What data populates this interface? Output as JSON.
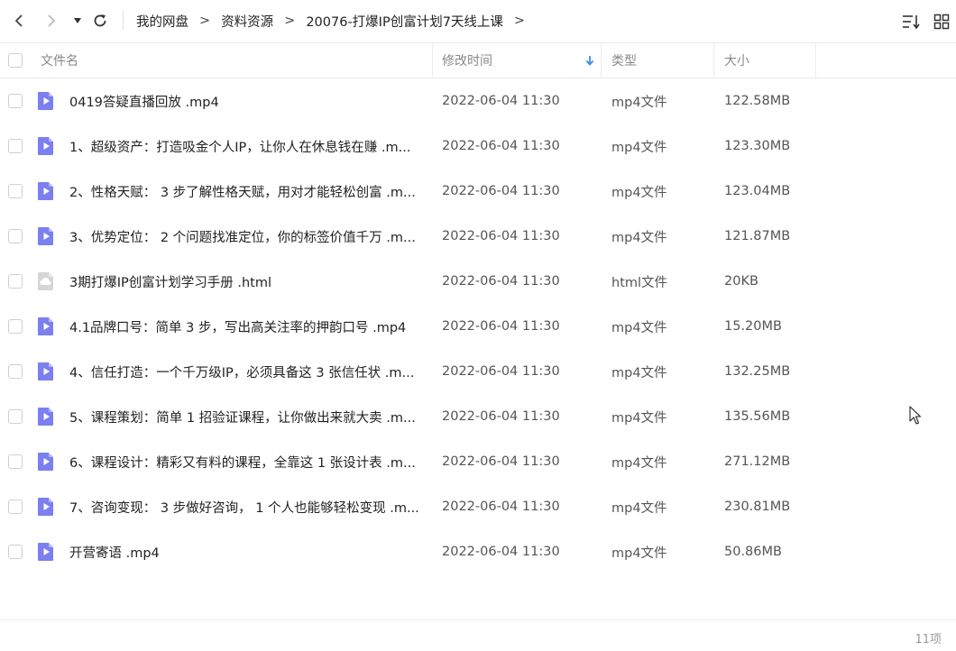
{
  "nav": {
    "back_icon": "chevron-left-icon",
    "forward_icon": "chevron-right-icon",
    "dropdown_icon": "caret-down-icon",
    "refresh_icon": "refresh-icon",
    "breadcrumb": [
      "我的网盘",
      "资料资源",
      "20076-打爆IP创富计划7天线上课"
    ],
    "separator": ">",
    "sort_view_icon": "sort-list-icon",
    "grid_view_icon": "grid-view-icon"
  },
  "columns": {
    "name": "文件名",
    "modified": "修改时间",
    "type": "类型",
    "size": "大小",
    "sort_icon": "arrow-down-icon"
  },
  "colors": {
    "video_icon": "#7b7ff0",
    "html_icon": "#d6d6d6",
    "sort_arrow": "#3a8ee6"
  },
  "files": [
    {
      "name": "0419答疑直播回放 .mp4",
      "modified": "2022-06-04 11:30",
      "type": "mp4文件",
      "size": "122.58MB",
      "icon": "video-file-icon"
    },
    {
      "name": "1、超级资产：打造吸金个人IP，让你人在休息钱在赚 .m...",
      "modified": "2022-06-04 11:30",
      "type": "mp4文件",
      "size": "123.30MB",
      "icon": "video-file-icon"
    },
    {
      "name": "2、性格天赋： 3 步了解性格天赋，用对才能轻松创富 .m...",
      "modified": "2022-06-04 11:30",
      "type": "mp4文件",
      "size": "123.04MB",
      "icon": "video-file-icon"
    },
    {
      "name": "3、优势定位： 2 个问题找准定位，你的标签价值千万 .m...",
      "modified": "2022-06-04 11:30",
      "type": "mp4文件",
      "size": "121.87MB",
      "icon": "video-file-icon"
    },
    {
      "name": "3期打爆IP创富计划学习手册 .html",
      "modified": "2022-06-04 11:30",
      "type": "html文件",
      "size": "20KB",
      "icon": "html-file-icon"
    },
    {
      "name": "4.1品牌口号：简单 3 步，写出高关注率的押韵口号 .mp4",
      "modified": "2022-06-04 11:30",
      "type": "mp4文件",
      "size": "15.20MB",
      "icon": "video-file-icon"
    },
    {
      "name": "4、信任打造：一个千万级IP，必须具备这 3 张信任状 .m...",
      "modified": "2022-06-04 11:30",
      "type": "mp4文件",
      "size": "132.25MB",
      "icon": "video-file-icon"
    },
    {
      "name": "5、课程策划：简单 1 招验证课程，让你做出来就大卖 .m...",
      "modified": "2022-06-04 11:30",
      "type": "mp4文件",
      "size": "135.56MB",
      "icon": "video-file-icon"
    },
    {
      "name": "6、课程设计：精彩又有料的课程，全靠这 1 张设计表 .m...",
      "modified": "2022-06-04 11:30",
      "type": "mp4文件",
      "size": "271.12MB",
      "icon": "video-file-icon"
    },
    {
      "name": "7、咨询变现： 3 步做好咨询， 1 个人也能够轻松变现 .m...",
      "modified": "2022-06-04 11:30",
      "type": "mp4文件",
      "size": "230.81MB",
      "icon": "video-file-icon"
    },
    {
      "name": "开营寄语 .mp4",
      "modified": "2022-06-04 11:30",
      "type": "mp4文件",
      "size": "50.86MB",
      "icon": "video-file-icon"
    }
  ],
  "footer": {
    "count": "11项"
  }
}
